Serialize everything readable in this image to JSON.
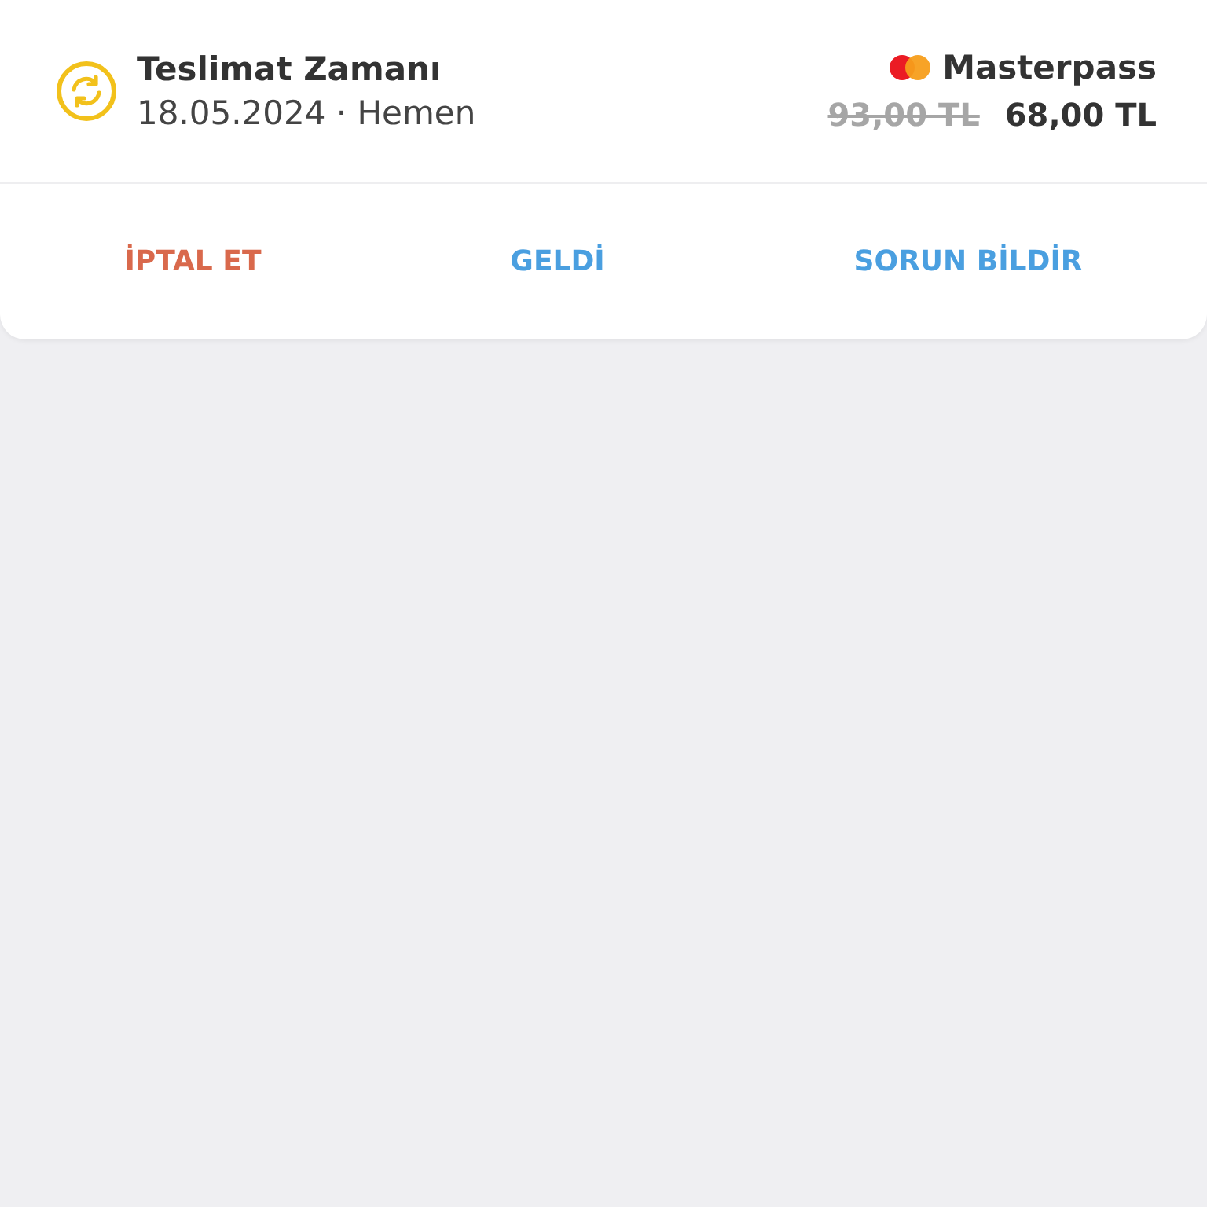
{
  "order": {
    "title": "Teslimat Zamanı",
    "subtitle": "18.05.2024 · Hemen",
    "payment_method": "Masterpass",
    "old_price": "93,00 TL",
    "price": "68,00 TL"
  },
  "actions": [
    {
      "label": "İPTAL ET",
      "kind": "danger"
    },
    {
      "label": "GELDİ",
      "kind": "primary"
    },
    {
      "label": "SORUN BİLDİR",
      "kind": "primary"
    }
  ]
}
